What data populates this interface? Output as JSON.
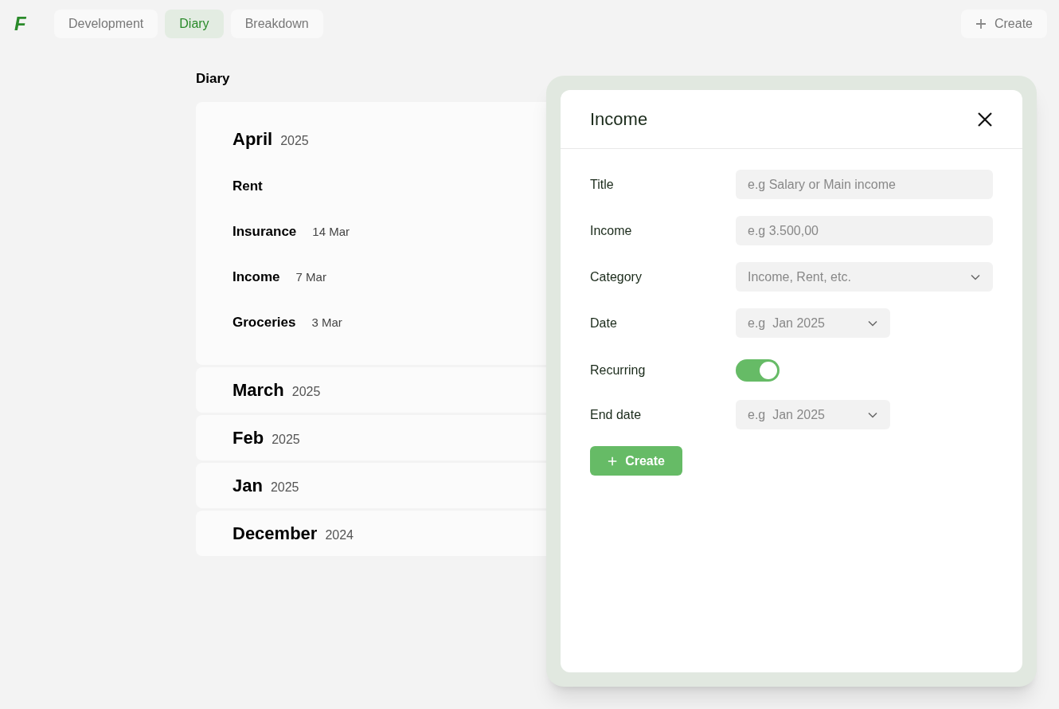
{
  "logo": "F",
  "nav_tabs": [
    {
      "label": "Development",
      "selected": false
    },
    {
      "label": "Diary",
      "selected": true
    },
    {
      "label": "Breakdown",
      "selected": false
    }
  ],
  "create_button": {
    "label": "Create"
  },
  "diary": {
    "title": "Diary",
    "months": [
      {
        "month": "April",
        "year": "2025",
        "expanded": true,
        "entries": [
          {
            "title": "Rent"
          },
          {
            "title": "Insurance",
            "date": "14 Mar"
          },
          {
            "title": "Income",
            "date": "7 Mar"
          },
          {
            "title": "Groceries",
            "date": "3 Mar"
          }
        ]
      },
      {
        "month": "March",
        "year": "2025",
        "expanded": false
      },
      {
        "month": "Feb",
        "year": "2025",
        "expanded": false
      },
      {
        "month": "Jan",
        "year": "2025",
        "expanded": false
      },
      {
        "month": "December",
        "year": "2024",
        "expanded": false
      }
    ]
  },
  "modal": {
    "title": "Income",
    "fields": [
      {
        "kind": "input",
        "label": "Title",
        "placeholder": "e.g Salary or Main income"
      },
      {
        "kind": "input",
        "label": "Income",
        "placeholder": "e.g 3.500,00"
      },
      {
        "kind": "select",
        "label": "Category",
        "placeholder": "Income, Rent, etc.",
        "wide": true
      },
      {
        "kind": "select",
        "label": "Date",
        "placeholder": "e.g  Jan 2025",
        "wide": false
      },
      {
        "kind": "toggle",
        "label": "Recurring",
        "on": true
      },
      {
        "kind": "select",
        "label": "End date",
        "placeholder": "e.g  Jan 2025",
        "wide": false
      }
    ],
    "submit": {
      "label": "Create"
    }
  }
}
